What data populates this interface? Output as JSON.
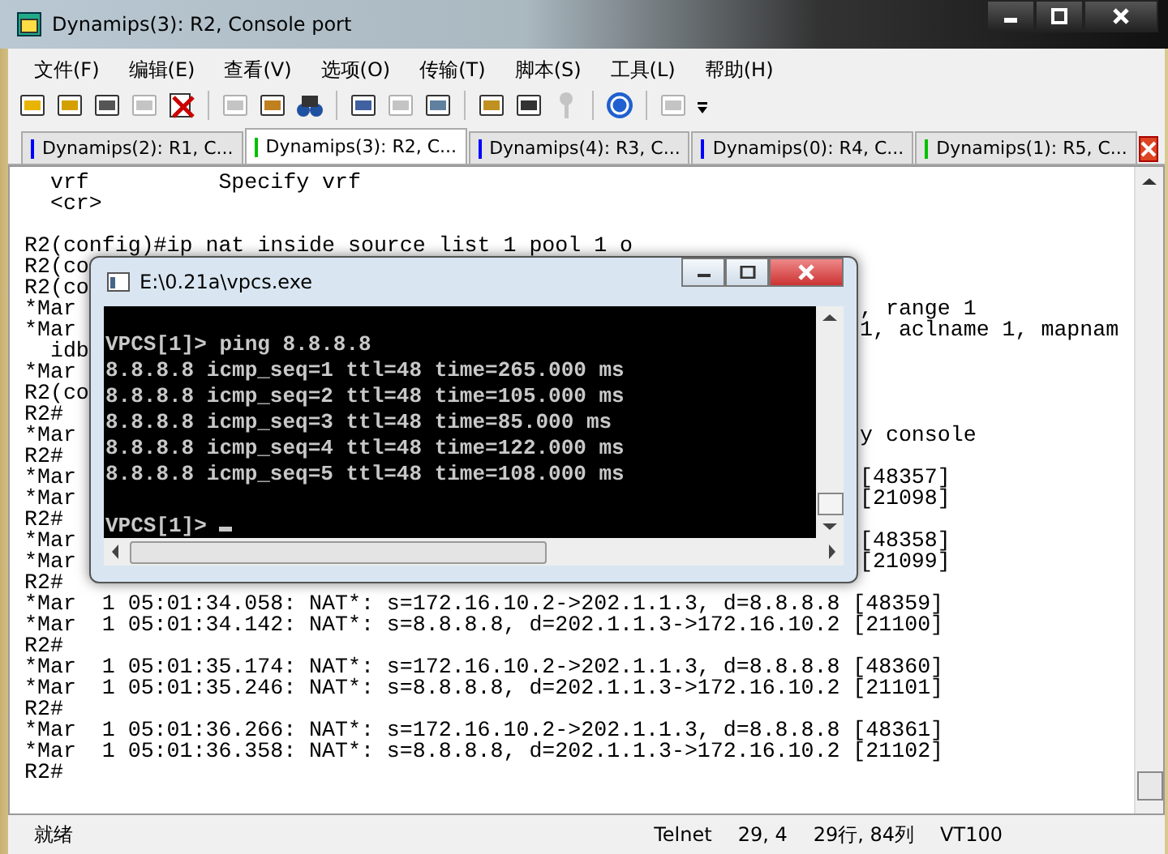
{
  "window": {
    "title": "Dynamips(3): R2, Console port"
  },
  "menu": [
    "文件(F)",
    "编辑(E)",
    "查看(V)",
    "选项(O)",
    "传输(T)",
    "脚本(S)",
    "工具(L)",
    "帮助(H)"
  ],
  "toolbar": [
    {
      "kind": "new",
      "disabled": false
    },
    {
      "kind": "quick",
      "disabled": false
    },
    {
      "kind": "tab",
      "disabled": false
    },
    {
      "kind": "reconnect",
      "disabled": true
    },
    {
      "kind": "disconnect",
      "disabled": false
    },
    {
      "kind": "separator"
    },
    {
      "kind": "copy",
      "disabled": true
    },
    {
      "kind": "paste",
      "disabled": false
    },
    {
      "kind": "find",
      "disabled": false
    },
    {
      "kind": "separator"
    },
    {
      "kind": "printsetup",
      "disabled": false
    },
    {
      "kind": "printsel",
      "disabled": true
    },
    {
      "kind": "print",
      "disabled": false
    },
    {
      "kind": "separator"
    },
    {
      "kind": "options",
      "disabled": false
    },
    {
      "kind": "global",
      "disabled": false
    },
    {
      "kind": "key",
      "disabled": true
    },
    {
      "kind": "separator"
    },
    {
      "kind": "help",
      "disabled": false
    },
    {
      "kind": "separator"
    },
    {
      "kind": "map",
      "disabled": true
    },
    {
      "kind": "more"
    }
  ],
  "tabs": [
    {
      "label": "Dynamips(2): R1, C...",
      "color": "#0000ff",
      "selected": false
    },
    {
      "label": "Dynamips(3): R2, C...",
      "color": "#00c000",
      "selected": true
    },
    {
      "label": "Dynamips(4): R3, C...",
      "color": "#0000ff",
      "selected": false
    },
    {
      "label": "Dynamips(0): R4, C...",
      "color": "#0000ff",
      "selected": false
    },
    {
      "label": "Dynamips(1): R5, C...",
      "color": "#00c000",
      "selected": false
    }
  ],
  "terminal": [
    {
      "text": "  vrf          Specify vrf"
    },
    {
      "text": "  <cr>"
    },
    {
      "text": "R2(config)#ip nat inside source list 1 pool 1 o",
      "spaced": true
    },
    {
      "text": "R2(co"
    },
    {
      "text": "R2(co"
    },
    {
      "text": "*Mar",
      "right": ", range 1"
    },
    {
      "text": "*Mar",
      "right": "1, aclname 1, mapnam"
    },
    {
      "text": "  idb"
    },
    {
      "text": "*Mar"
    },
    {
      "text": "R2(co"
    },
    {
      "text": "R2#"
    },
    {
      "text": "*Mar",
      "right": "y console"
    },
    {
      "text": "R2#"
    },
    {
      "text": "*Mar",
      "right": "[48357]"
    },
    {
      "text": "*Mar",
      "right": "[21098]"
    },
    {
      "text": "R2#"
    },
    {
      "text": "*Mar",
      "right": "[48358]"
    },
    {
      "text": "*Mar",
      "right": "[21099]"
    },
    {
      "text": "R2#"
    },
    {
      "text": "*Mar  1 05:01:34.058: NAT*: s=172.16.10.2->202.1.1.3, d=8.8.8.8 [48359]"
    },
    {
      "text": "*Mar  1 05:01:34.142: NAT*: s=8.8.8.8, d=202.1.1.3->172.16.10.2 [21100]"
    },
    {
      "text": "R2#"
    },
    {
      "text": "*Mar  1 05:01:35.174: NAT*: s=172.16.10.2->202.1.1.3, d=8.8.8.8 [48360]"
    },
    {
      "text": "*Mar  1 05:01:35.246: NAT*: s=8.8.8.8, d=202.1.1.3->172.16.10.2 [21101]"
    },
    {
      "text": "R2#"
    },
    {
      "text": "*Mar  1 05:01:36.266: NAT*: s=172.16.10.2->202.1.1.3, d=8.8.8.8 [48361]"
    },
    {
      "text": "*Mar  1 05:01:36.358: NAT*: s=8.8.8.8, d=202.1.1.3->172.16.10.2 [21102]"
    },
    {
      "text": "R2#"
    }
  ],
  "vpcs": {
    "title": "E:\\0.21a\\vpcs.exe",
    "lines": [
      {
        "text": "VPCS[1]> ping 8.8.8.8",
        "spaced": true
      },
      {
        "text": "8.8.8.8 icmp_seq=1 ttl=48 time=265.000 ms"
      },
      {
        "text": "8.8.8.8 icmp_seq=2 ttl=48 time=105.000 ms"
      },
      {
        "text": "8.8.8.8 icmp_seq=3 ttl=48 time=85.000 ms"
      },
      {
        "text": "8.8.8.8 icmp_seq=4 ttl=48 time=122.000 ms"
      },
      {
        "text": "8.8.8.8 icmp_seq=5 ttl=48 time=108.000 ms"
      },
      {
        "text": "VPCS[1]>",
        "spaced": true
      }
    ]
  },
  "status_bar": {
    "state": "就绪",
    "protocol": "Telnet",
    "position": "29,  4",
    "size": "29行, 84列",
    "emulation": "VT100"
  }
}
